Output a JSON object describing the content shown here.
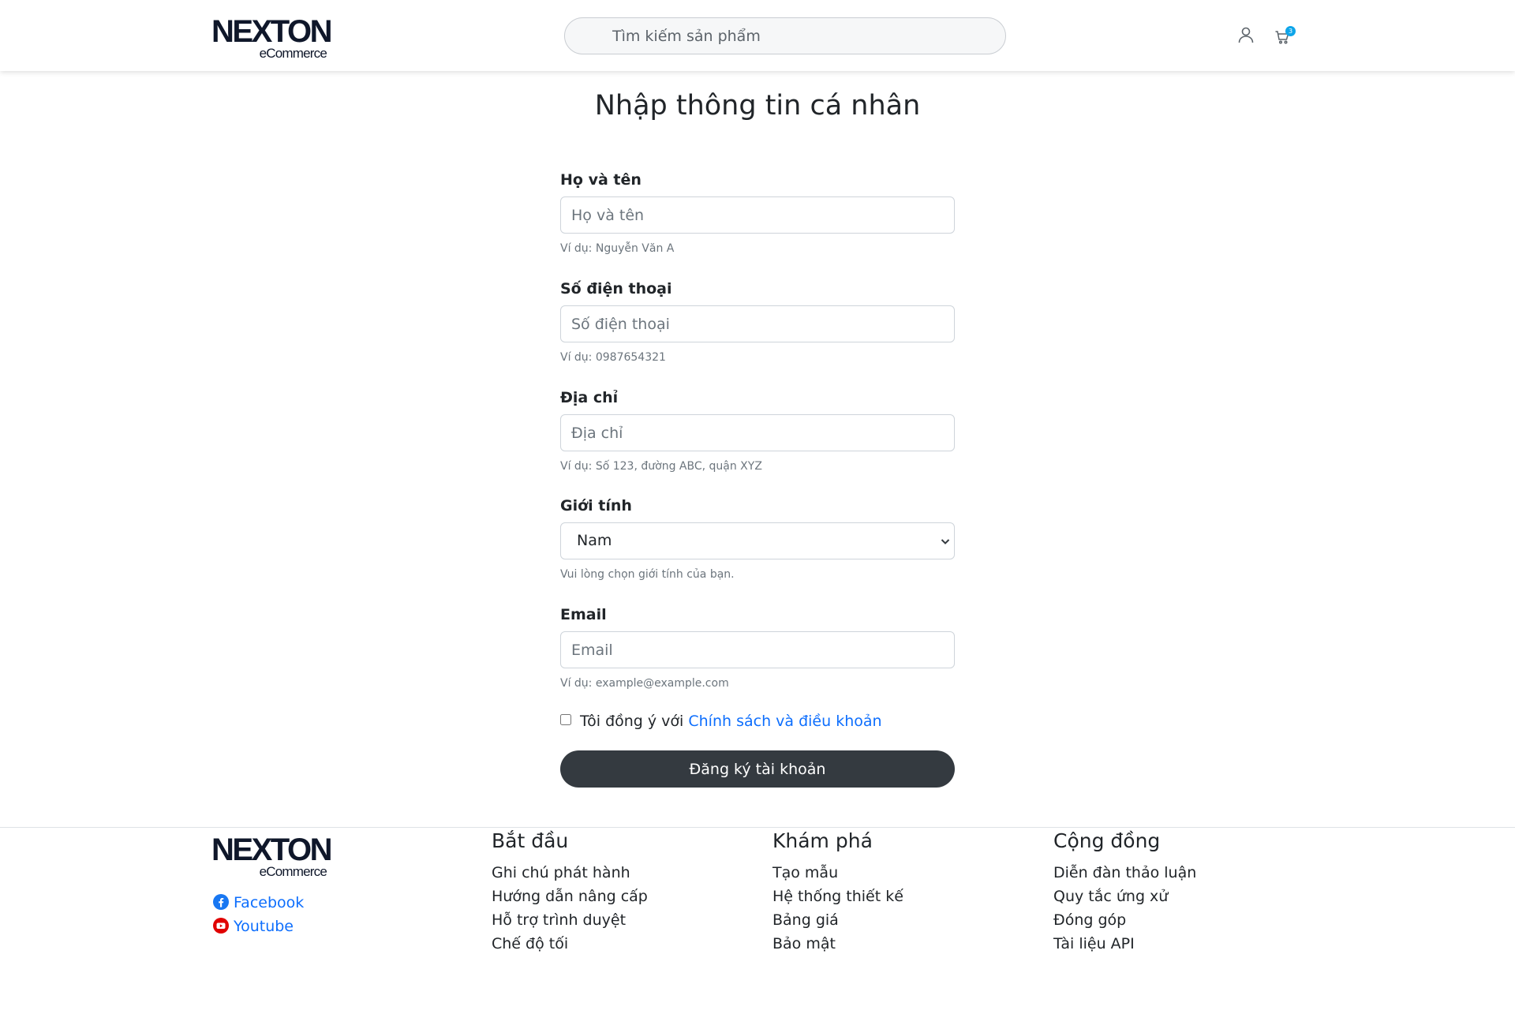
{
  "header": {
    "logo_main": "NEXTON",
    "logo_sub": "eCommerce",
    "search_placeholder": "Tìm kiếm sản phẩm",
    "cart_count": "3"
  },
  "form": {
    "title": "Nhập thông tin cá nhân",
    "fields": [
      {
        "label": "Họ và tên",
        "placeholder": "Họ và tên",
        "help": "Ví dụ: Nguyễn Văn A"
      },
      {
        "label": "Số điện thoại",
        "placeholder": "Số điện thoại",
        "help": "Ví dụ: 0987654321"
      },
      {
        "label": "Địa chỉ",
        "placeholder": "Địa chỉ",
        "help": "Ví dụ: Số 123, đường ABC, quận XYZ"
      },
      {
        "label": "Giới tính",
        "selected": "Nam",
        "help": "Vui lòng chọn giới tính của bạn."
      },
      {
        "label": "Email",
        "placeholder": "Email",
        "help": "Ví dụ: example@example.com"
      }
    ],
    "agree_prefix": "Tôi đồng ý với",
    "agree_link": "Chính sách và điều khoản",
    "submit_label": "Đăng ký tài khoản"
  },
  "footer": {
    "logo_main": "NEXTON",
    "logo_sub": "eCommerce",
    "social": [
      {
        "label": "Facebook",
        "icon": "facebook-icon"
      },
      {
        "label": "Youtube",
        "icon": "youtube-icon"
      }
    ],
    "columns": [
      {
        "title": "Bắt đầu",
        "links": [
          "Ghi chú phát hành",
          "Hướng dẫn nâng cấp",
          "Hỗ trợ trình duyệt",
          "Chế độ tối"
        ]
      },
      {
        "title": "Khám phá",
        "links": [
          "Tạo mẫu",
          "Hệ thống thiết kế",
          "Bảng giá",
          "Bảo mật"
        ]
      },
      {
        "title": "Cộng đồng",
        "links": [
          "Diễn đàn thảo luận",
          "Quy tắc ứng xử",
          "Đóng góp",
          "Tài liệu API"
        ]
      }
    ]
  },
  "colors": {
    "link": "#0d6efd",
    "button_dark": "#343a40",
    "badge": "#0ea5e9",
    "facebook": "#1877f2",
    "youtube": "#e00000"
  }
}
